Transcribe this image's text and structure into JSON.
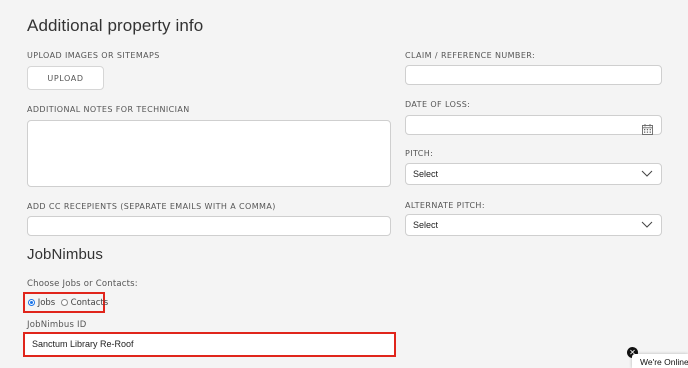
{
  "section": {
    "title": "Additional property info"
  },
  "left": {
    "upload_label": "UPLOAD IMAGES OR SITEMAPS",
    "upload_button": "UPLOAD",
    "notes_label": "ADDITIONAL NOTES FOR TECHNICIAN",
    "notes_value": "",
    "cc_label": "ADD CC RECEPIENTS (SEPARATE EMAILS WITH A COMMA)",
    "cc_value": ""
  },
  "right": {
    "claim_label": "CLAIM / REFERENCE NUMBER:",
    "claim_value": "",
    "loss_label": "DATE OF LOSS:",
    "loss_value": "",
    "pitch_label": "PITCH:",
    "pitch_value": "Select",
    "alt_pitch_label": "ALTERNATE PITCH:",
    "alt_pitch_value": "Select"
  },
  "jobnimbus": {
    "title": "JobNimbus",
    "choose_label": "Choose Jobs or Contacts:",
    "options": [
      {
        "label": "Jobs",
        "selected": true
      },
      {
        "label": "Contacts",
        "selected": false
      }
    ],
    "id_label": "JobNimbus ID",
    "id_value": "Sanctum Library Re-Roof"
  },
  "chat": {
    "online_text": "We're Online!",
    "close_icon": "close-icon"
  },
  "colors": {
    "highlight": "#e0251b",
    "radio_selected": "#1a73e8"
  }
}
